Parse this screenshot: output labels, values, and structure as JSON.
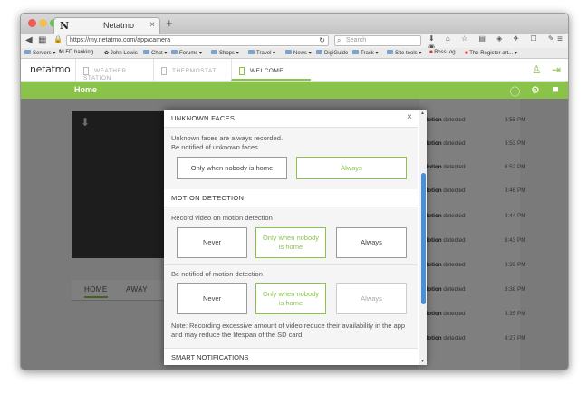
{
  "browser": {
    "tab_title": "Netatmo",
    "tab_favicon": "N",
    "tab_close": "×",
    "new_tab": "+",
    "url": "https://my.netatmo.com/app/camera",
    "search_placeholder": "Search",
    "toolbar_icons": "⬇ ⌂ ☆ ▤ ◈ ✈ ☐ ✎ ◉",
    "bookmarks": [
      "Servers ▾",
      "FD banking",
      "John Lewis",
      "Chat ▾",
      "Forums ▾",
      "Shops ▾",
      "Travel ▾",
      "News ▾",
      "DigiGuide",
      "Track ▾",
      "Site tools ▾",
      "BossLog",
      "The Register art... ▾"
    ]
  },
  "app": {
    "logo": "netatmo",
    "products": [
      "WEATHER STATION",
      "THERMOSTAT",
      "WELCOME"
    ],
    "page_title": "Home",
    "accent": "#8bc34a"
  },
  "camera": {
    "modes": [
      "HOME",
      "AWAY"
    ]
  },
  "events": [
    {
      "who": "Motion",
      "what": "detected",
      "time": "8:55 PM"
    },
    {
      "who": "Motion",
      "what": "detected",
      "time": "8:53 PM"
    },
    {
      "who": "Motion",
      "what": "detected",
      "time": "8:52 PM"
    },
    {
      "who": "Motion",
      "what": "detected",
      "time": "8:46 PM"
    },
    {
      "who": "Motion",
      "what": "detected",
      "time": "8:44 PM"
    },
    {
      "who": "Motion",
      "what": "detected",
      "time": "8:43 PM"
    },
    {
      "who": "Motion",
      "what": "detected",
      "time": "8:39 PM"
    },
    {
      "who": "Motion",
      "what": "detected",
      "time": "8:38 PM"
    },
    {
      "who": "Motion",
      "what": "detected",
      "time": "8:35 PM"
    },
    {
      "who": "Motion",
      "what": "detected",
      "time": "8:27 PM"
    }
  ],
  "modal": {
    "unknown_faces": {
      "title": "UNKNOWN FACES",
      "line1": "Unknown faces are always recorded.",
      "line2": "Be notified of unknown faces",
      "options": [
        "Only when nobody is home",
        "Always"
      ]
    },
    "motion": {
      "title": "MOTION DETECTION",
      "record_label": "Record video on motion detection",
      "record_options": [
        "Never",
        "Only when nobody is home",
        "Always"
      ],
      "notify_label": "Be notified of motion detection",
      "notify_options": [
        "Never",
        "Only when nobody is home",
        "Always"
      ],
      "note": "Note: Recording excessive amount of video reduce their availability in the app and may reduce the lifespan of the SD card."
    },
    "next_section_partial": "SMART NOTIFICATIONS"
  }
}
